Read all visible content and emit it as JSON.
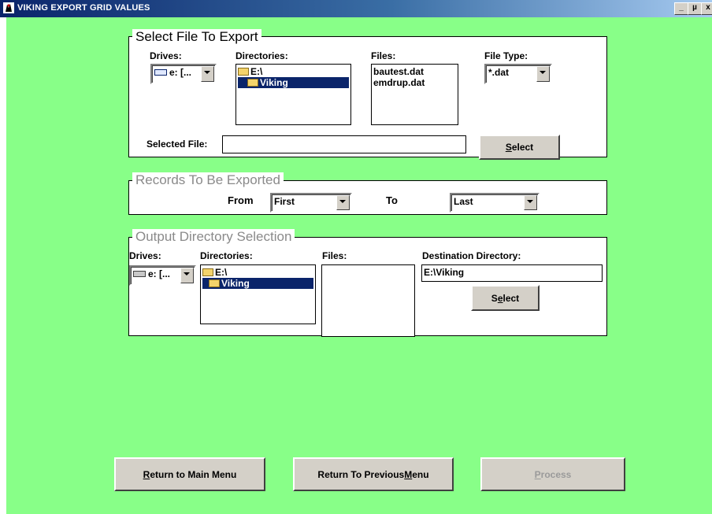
{
  "window": {
    "title": "VIKING EXPORT GRID VALUES",
    "controls": [
      "_",
      "µ",
      "x"
    ]
  },
  "colors": {
    "background": "#88ff88",
    "selection": "#0a246a",
    "title_bar": "#0a246a"
  },
  "select_file": {
    "legend": "Select File To Export",
    "drives_label": "Drives:",
    "drive_value": "e: [...",
    "directories_label": "Directories:",
    "directories": [
      "E:\\",
      "Viking"
    ],
    "files_label": "Files:",
    "files": [
      "bautest.dat",
      "emdrup.dat"
    ],
    "file_type_label": "File Type:",
    "file_type_value": "*.dat",
    "selected_file_label": "Selected File:",
    "selected_file_value": "",
    "select_button": {
      "label": "Select",
      "hotkey": "S",
      "rest": "elect"
    }
  },
  "records": {
    "legend": "Records To Be Exported",
    "from_label": "From",
    "from_value": "First",
    "to_label": "To",
    "to_value": "Last"
  },
  "output": {
    "legend": "Output Directory Selection",
    "drives_label": "Drives:",
    "drive_value": "e: [...",
    "directories_label": "Directories:",
    "directories": [
      "E:\\",
      "Viking"
    ],
    "files_label": "Files:",
    "destination_label": "Destination Directory:",
    "destination_value": "E:\\Viking",
    "select_button": {
      "label": "Select",
      "hotkey": "e",
      "pre": "S",
      "rest": "lect"
    }
  },
  "buttons": {
    "main_menu": {
      "hotkey": "R",
      "rest": "eturn to Main Menu"
    },
    "previous_menu": {
      "pre": "Return To Previous ",
      "hotkey": "M",
      "rest": "enu"
    },
    "process": {
      "hotkey": "P",
      "rest": "rocess",
      "enabled": false
    }
  }
}
